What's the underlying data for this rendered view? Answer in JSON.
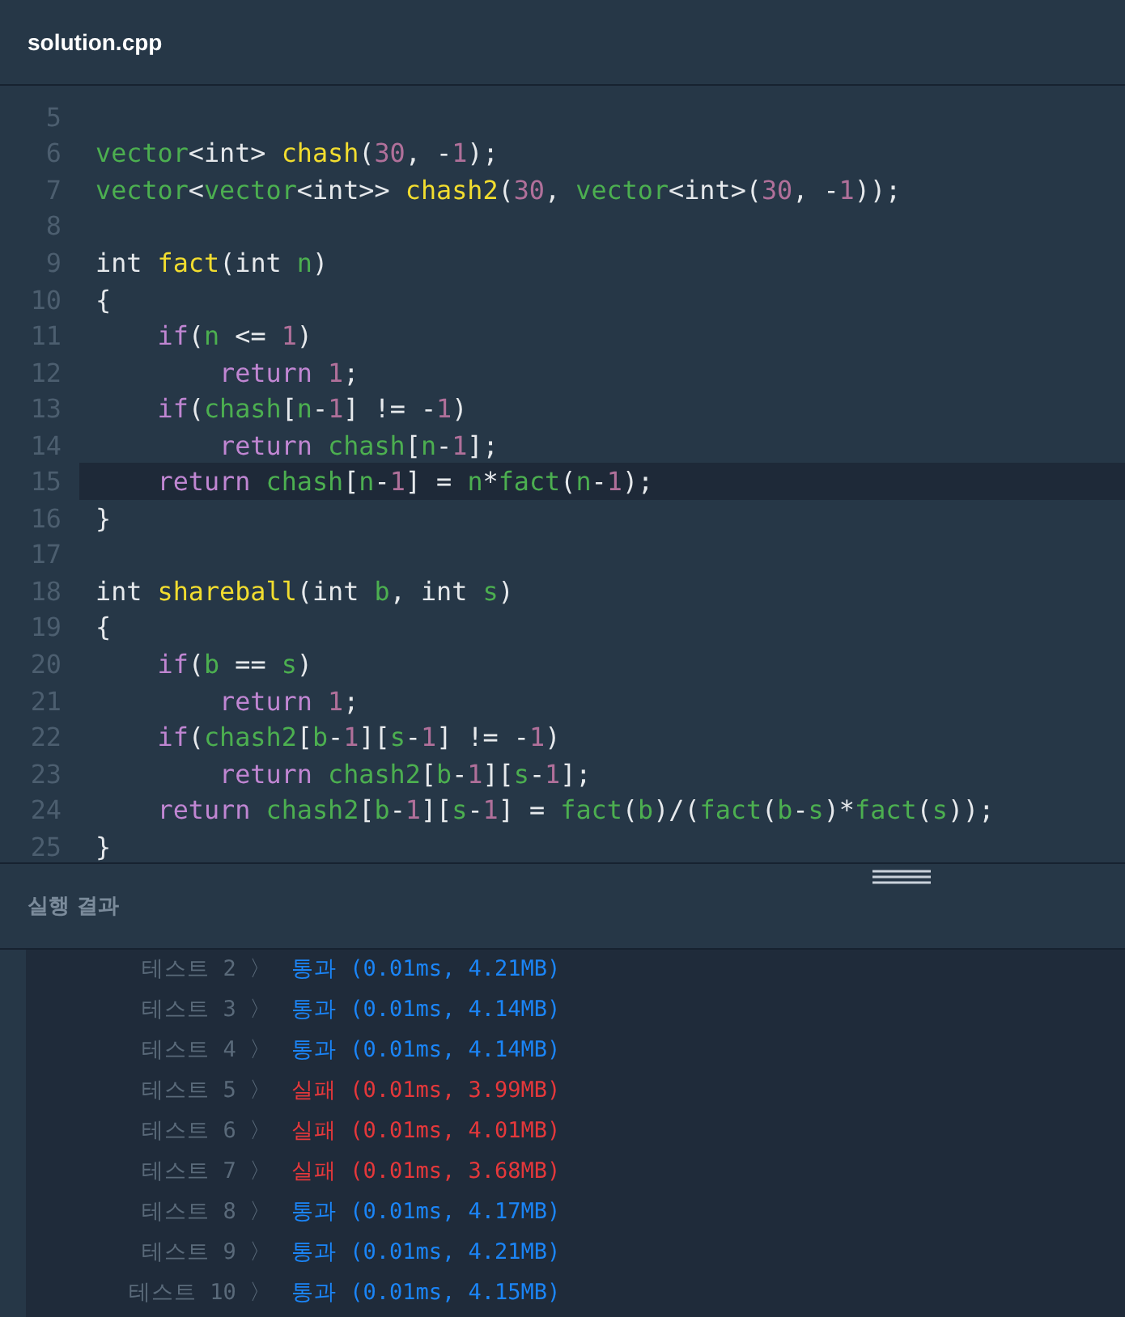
{
  "file_tab": {
    "title": "solution.cpp"
  },
  "code_lines": [
    {
      "number": "5",
      "current": false
    },
    {
      "number": "6",
      "current": false,
      "tokens": [
        {
          "kind": "type",
          "text": "vector"
        },
        {
          "kind": "plain",
          "text": "<int> "
        },
        {
          "kind": "func",
          "text": "chash"
        },
        {
          "kind": "plain",
          "text": "("
        },
        {
          "kind": "num",
          "text": "30"
        },
        {
          "kind": "plain",
          "text": ", -"
        },
        {
          "kind": "num",
          "text": "1"
        },
        {
          "kind": "plain",
          "text": ");"
        }
      ]
    },
    {
      "number": "7",
      "current": false,
      "tokens": [
        {
          "kind": "type",
          "text": "vector"
        },
        {
          "kind": "plain",
          "text": "<"
        },
        {
          "kind": "type",
          "text": "vector"
        },
        {
          "kind": "plain",
          "text": "<int>> "
        },
        {
          "kind": "func",
          "text": "chash2"
        },
        {
          "kind": "plain",
          "text": "("
        },
        {
          "kind": "num",
          "text": "30"
        },
        {
          "kind": "plain",
          "text": ", "
        },
        {
          "kind": "type",
          "text": "vector"
        },
        {
          "kind": "plain",
          "text": "<int>("
        },
        {
          "kind": "num",
          "text": "30"
        },
        {
          "kind": "plain",
          "text": ", -"
        },
        {
          "kind": "num",
          "text": "1"
        },
        {
          "kind": "plain",
          "text": "));"
        }
      ]
    },
    {
      "number": "8",
      "current": false
    },
    {
      "number": "9",
      "current": false,
      "tokens": [
        {
          "kind": "plain",
          "text": "int "
        },
        {
          "kind": "func",
          "text": "fact"
        },
        {
          "kind": "plain",
          "text": "(int "
        },
        {
          "kind": "ident",
          "text": "n"
        },
        {
          "kind": "plain",
          "text": ")"
        }
      ]
    },
    {
      "number": "10",
      "current": false,
      "tokens": [
        {
          "kind": "plain",
          "text": "{"
        }
      ]
    },
    {
      "number": "11",
      "current": false,
      "tokens": [
        {
          "kind": "keyword",
          "text": "    if"
        },
        {
          "kind": "plain",
          "text": "("
        },
        {
          "kind": "ident",
          "text": "n"
        },
        {
          "kind": "plain",
          "text": " <= "
        },
        {
          "kind": "num",
          "text": "1"
        },
        {
          "kind": "plain",
          "text": ")"
        }
      ]
    },
    {
      "number": "12",
      "current": false,
      "tokens": [
        {
          "kind": "keyword",
          "text": "        return "
        },
        {
          "kind": "num",
          "text": "1"
        },
        {
          "kind": "plain",
          "text": ";"
        }
      ]
    },
    {
      "number": "13",
      "current": false,
      "tokens": [
        {
          "kind": "keyword",
          "text": "    if"
        },
        {
          "kind": "plain",
          "text": "("
        },
        {
          "kind": "ident",
          "text": "chash"
        },
        {
          "kind": "plain",
          "text": "["
        },
        {
          "kind": "ident",
          "text": "n"
        },
        {
          "kind": "plain",
          "text": "-"
        },
        {
          "kind": "num",
          "text": "1"
        },
        {
          "kind": "plain",
          "text": "] != -"
        },
        {
          "kind": "num",
          "text": "1"
        },
        {
          "kind": "plain",
          "text": ")"
        }
      ]
    },
    {
      "number": "14",
      "current": false,
      "tokens": [
        {
          "kind": "keyword",
          "text": "        return "
        },
        {
          "kind": "ident",
          "text": "chash"
        },
        {
          "kind": "plain",
          "text": "["
        },
        {
          "kind": "ident",
          "text": "n"
        },
        {
          "kind": "plain",
          "text": "-"
        },
        {
          "kind": "num",
          "text": "1"
        },
        {
          "kind": "plain",
          "text": "];"
        }
      ]
    },
    {
      "number": "15",
      "current": true,
      "tokens": [
        {
          "kind": "keyword",
          "text": "    return "
        },
        {
          "kind": "ident",
          "text": "chash"
        },
        {
          "kind": "plain",
          "text": "["
        },
        {
          "kind": "ident",
          "text": "n"
        },
        {
          "kind": "plain",
          "text": "-"
        },
        {
          "kind": "num",
          "text": "1"
        },
        {
          "kind": "plain",
          "text": "] = "
        },
        {
          "kind": "ident",
          "text": "n"
        },
        {
          "kind": "plain",
          "text": "*"
        },
        {
          "kind": "ident",
          "text": "fact"
        },
        {
          "kind": "plain",
          "text": "("
        },
        {
          "kind": "ident",
          "text": "n"
        },
        {
          "kind": "plain",
          "text": "-"
        },
        {
          "kind": "num",
          "text": "1"
        },
        {
          "kind": "plain",
          "text": ");"
        }
      ]
    },
    {
      "number": "16",
      "current": false,
      "tokens": [
        {
          "kind": "plain",
          "text": "}"
        }
      ]
    },
    {
      "number": "17",
      "current": false
    },
    {
      "number": "18",
      "current": false,
      "tokens": [
        {
          "kind": "plain",
          "text": "int "
        },
        {
          "kind": "func",
          "text": "shareball"
        },
        {
          "kind": "plain",
          "text": "(int "
        },
        {
          "kind": "ident",
          "text": "b"
        },
        {
          "kind": "plain",
          "text": ", int "
        },
        {
          "kind": "ident",
          "text": "s"
        },
        {
          "kind": "plain",
          "text": ")"
        }
      ]
    },
    {
      "number": "19",
      "current": false,
      "tokens": [
        {
          "kind": "plain",
          "text": "{"
        }
      ]
    },
    {
      "number": "20",
      "current": false,
      "tokens": [
        {
          "kind": "keyword",
          "text": "    if"
        },
        {
          "kind": "plain",
          "text": "("
        },
        {
          "kind": "ident",
          "text": "b"
        },
        {
          "kind": "plain",
          "text": " == "
        },
        {
          "kind": "ident",
          "text": "s"
        },
        {
          "kind": "plain",
          "text": ")"
        }
      ]
    },
    {
      "number": "21",
      "current": false,
      "tokens": [
        {
          "kind": "keyword",
          "text": "        return "
        },
        {
          "kind": "num",
          "text": "1"
        },
        {
          "kind": "plain",
          "text": ";"
        }
      ]
    },
    {
      "number": "22",
      "current": false,
      "tokens": [
        {
          "kind": "keyword",
          "text": "    if"
        },
        {
          "kind": "plain",
          "text": "("
        },
        {
          "kind": "ident",
          "text": "chash2"
        },
        {
          "kind": "plain",
          "text": "["
        },
        {
          "kind": "ident",
          "text": "b"
        },
        {
          "kind": "plain",
          "text": "-"
        },
        {
          "kind": "num",
          "text": "1"
        },
        {
          "kind": "plain",
          "text": "]["
        },
        {
          "kind": "ident",
          "text": "s"
        },
        {
          "kind": "plain",
          "text": "-"
        },
        {
          "kind": "num",
          "text": "1"
        },
        {
          "kind": "plain",
          "text": "] != -"
        },
        {
          "kind": "num",
          "text": "1"
        },
        {
          "kind": "plain",
          "text": ")"
        }
      ]
    },
    {
      "number": "23",
      "current": false,
      "tokens": [
        {
          "kind": "keyword",
          "text": "        return "
        },
        {
          "kind": "ident",
          "text": "chash2"
        },
        {
          "kind": "plain",
          "text": "["
        },
        {
          "kind": "ident",
          "text": "b"
        },
        {
          "kind": "plain",
          "text": "-"
        },
        {
          "kind": "num",
          "text": "1"
        },
        {
          "kind": "plain",
          "text": "]["
        },
        {
          "kind": "ident",
          "text": "s"
        },
        {
          "kind": "plain",
          "text": "-"
        },
        {
          "kind": "num",
          "text": "1"
        },
        {
          "kind": "plain",
          "text": "];"
        }
      ]
    },
    {
      "number": "24",
      "current": false,
      "tokens": [
        {
          "kind": "keyword",
          "text": "    return "
        },
        {
          "kind": "ident",
          "text": "chash2"
        },
        {
          "kind": "plain",
          "text": "["
        },
        {
          "kind": "ident",
          "text": "b"
        },
        {
          "kind": "plain",
          "text": "-"
        },
        {
          "kind": "num",
          "text": "1"
        },
        {
          "kind": "plain",
          "text": "]["
        },
        {
          "kind": "ident",
          "text": "s"
        },
        {
          "kind": "plain",
          "text": "-"
        },
        {
          "kind": "num",
          "text": "1"
        },
        {
          "kind": "plain",
          "text": "] = "
        },
        {
          "kind": "ident",
          "text": "fact"
        },
        {
          "kind": "plain",
          "text": "("
        },
        {
          "kind": "ident",
          "text": "b"
        },
        {
          "kind": "plain",
          "text": ")/("
        },
        {
          "kind": "ident",
          "text": "fact"
        },
        {
          "kind": "plain",
          "text": "("
        },
        {
          "kind": "ident",
          "text": "b"
        },
        {
          "kind": "plain",
          "text": "-"
        },
        {
          "kind": "ident",
          "text": "s"
        },
        {
          "kind": "plain",
          "text": ")*"
        },
        {
          "kind": "ident",
          "text": "fact"
        },
        {
          "kind": "plain",
          "text": "("
        },
        {
          "kind": "ident",
          "text": "s"
        },
        {
          "kind": "plain",
          "text": "));"
        }
      ]
    },
    {
      "number": "25",
      "current": false,
      "tokens": [
        {
          "kind": "plain",
          "text": "}"
        }
      ]
    }
  ],
  "results": {
    "title": "실행 결과",
    "rows": [
      {
        "label": "테스트 2 〉",
        "passed": true,
        "result": "통과 (0.01ms, 4.21MB)"
      },
      {
        "label": "테스트 3 〉",
        "passed": true,
        "result": "통과 (0.01ms, 4.14MB)"
      },
      {
        "label": "테스트 4 〉",
        "passed": true,
        "result": "통과 (0.01ms, 4.14MB)"
      },
      {
        "label": "테스트 5 〉",
        "passed": false,
        "result": "실패 (0.01ms, 3.99MB)"
      },
      {
        "label": "테스트 6 〉",
        "passed": false,
        "result": "실패 (0.01ms, 4.01MB)"
      },
      {
        "label": "테스트 7 〉",
        "passed": false,
        "result": "실패 (0.01ms, 3.68MB)"
      },
      {
        "label": "테스트 8 〉",
        "passed": true,
        "result": "통과 (0.01ms, 4.17MB)"
      },
      {
        "label": "테스트 9 〉",
        "passed": true,
        "result": "통과 (0.01ms, 4.21MB)"
      },
      {
        "label": "테스트 10 〉",
        "passed": true,
        "result": "통과 (0.01ms, 4.15MB)"
      }
    ]
  }
}
